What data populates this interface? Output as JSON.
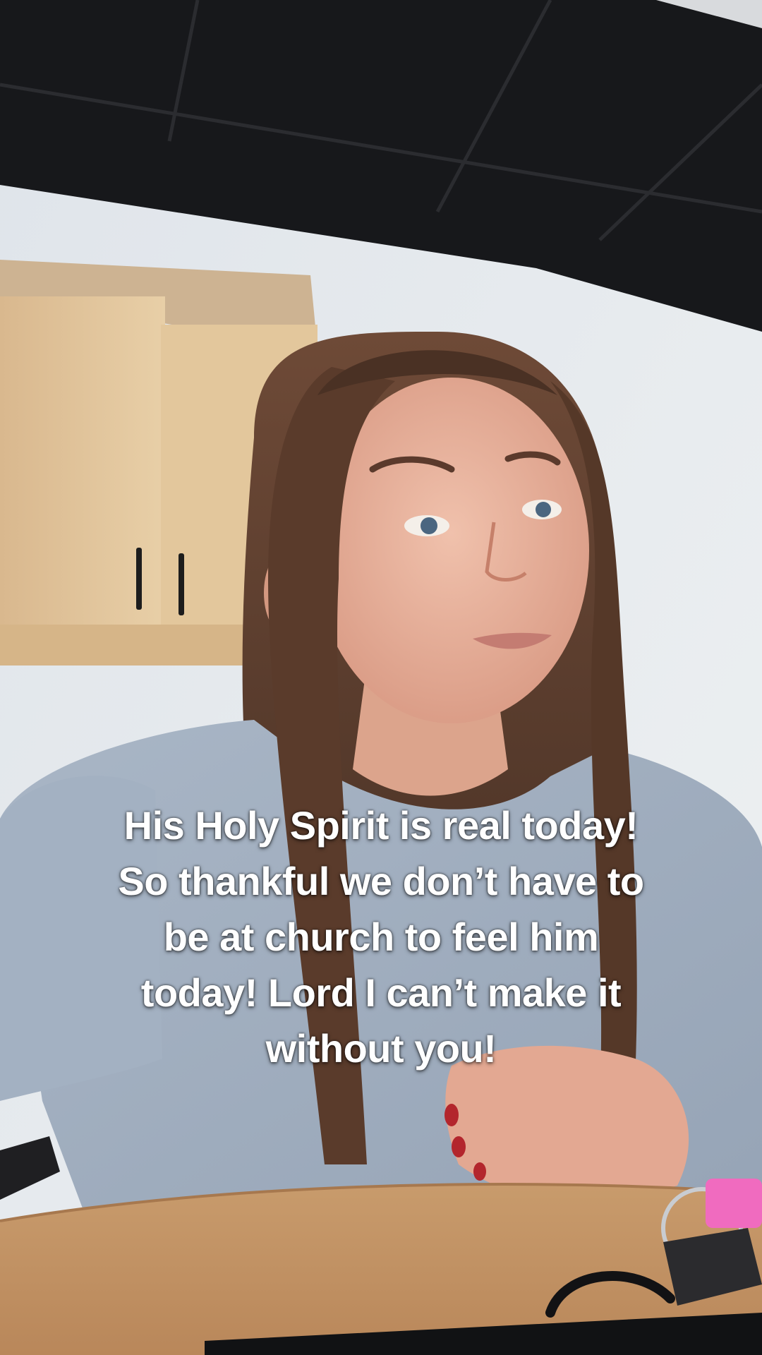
{
  "video": {
    "caption_lines": [
      "His Holy Spirit is real today!",
      "So thankful we don’t have to",
      "be at church to feel him",
      "today! Lord I can’t make it",
      "without you!"
    ]
  }
}
